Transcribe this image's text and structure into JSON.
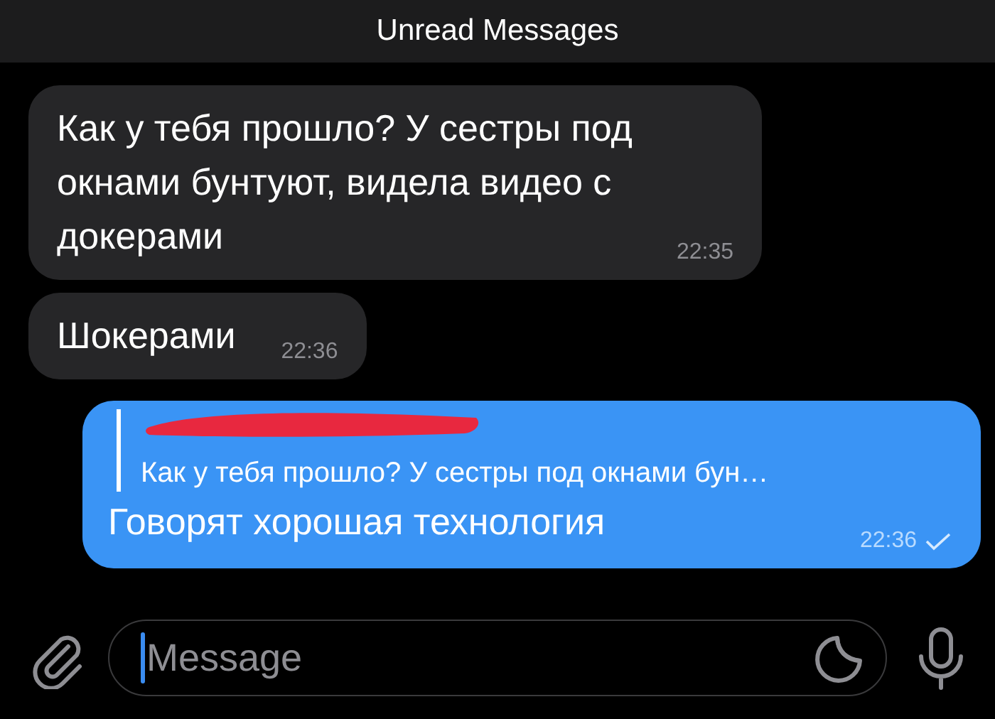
{
  "header": {
    "title": "Unread Messages"
  },
  "messages": [
    {
      "kind": "incoming",
      "text": "Как у тебя прошло? У сестры под окнами бунтуют, видела видео с докерами",
      "time": "22:35"
    },
    {
      "kind": "incoming",
      "text": "Шокерами",
      "time": "22:36"
    },
    {
      "kind": "outgoing",
      "reply": {
        "redacted": true,
        "text": "Как у тебя прошло? У сестры под окнами бун…"
      },
      "text": "Говорят хорошая технология",
      "time": "22:36",
      "read": false
    }
  ],
  "composer": {
    "placeholder": "Message"
  }
}
